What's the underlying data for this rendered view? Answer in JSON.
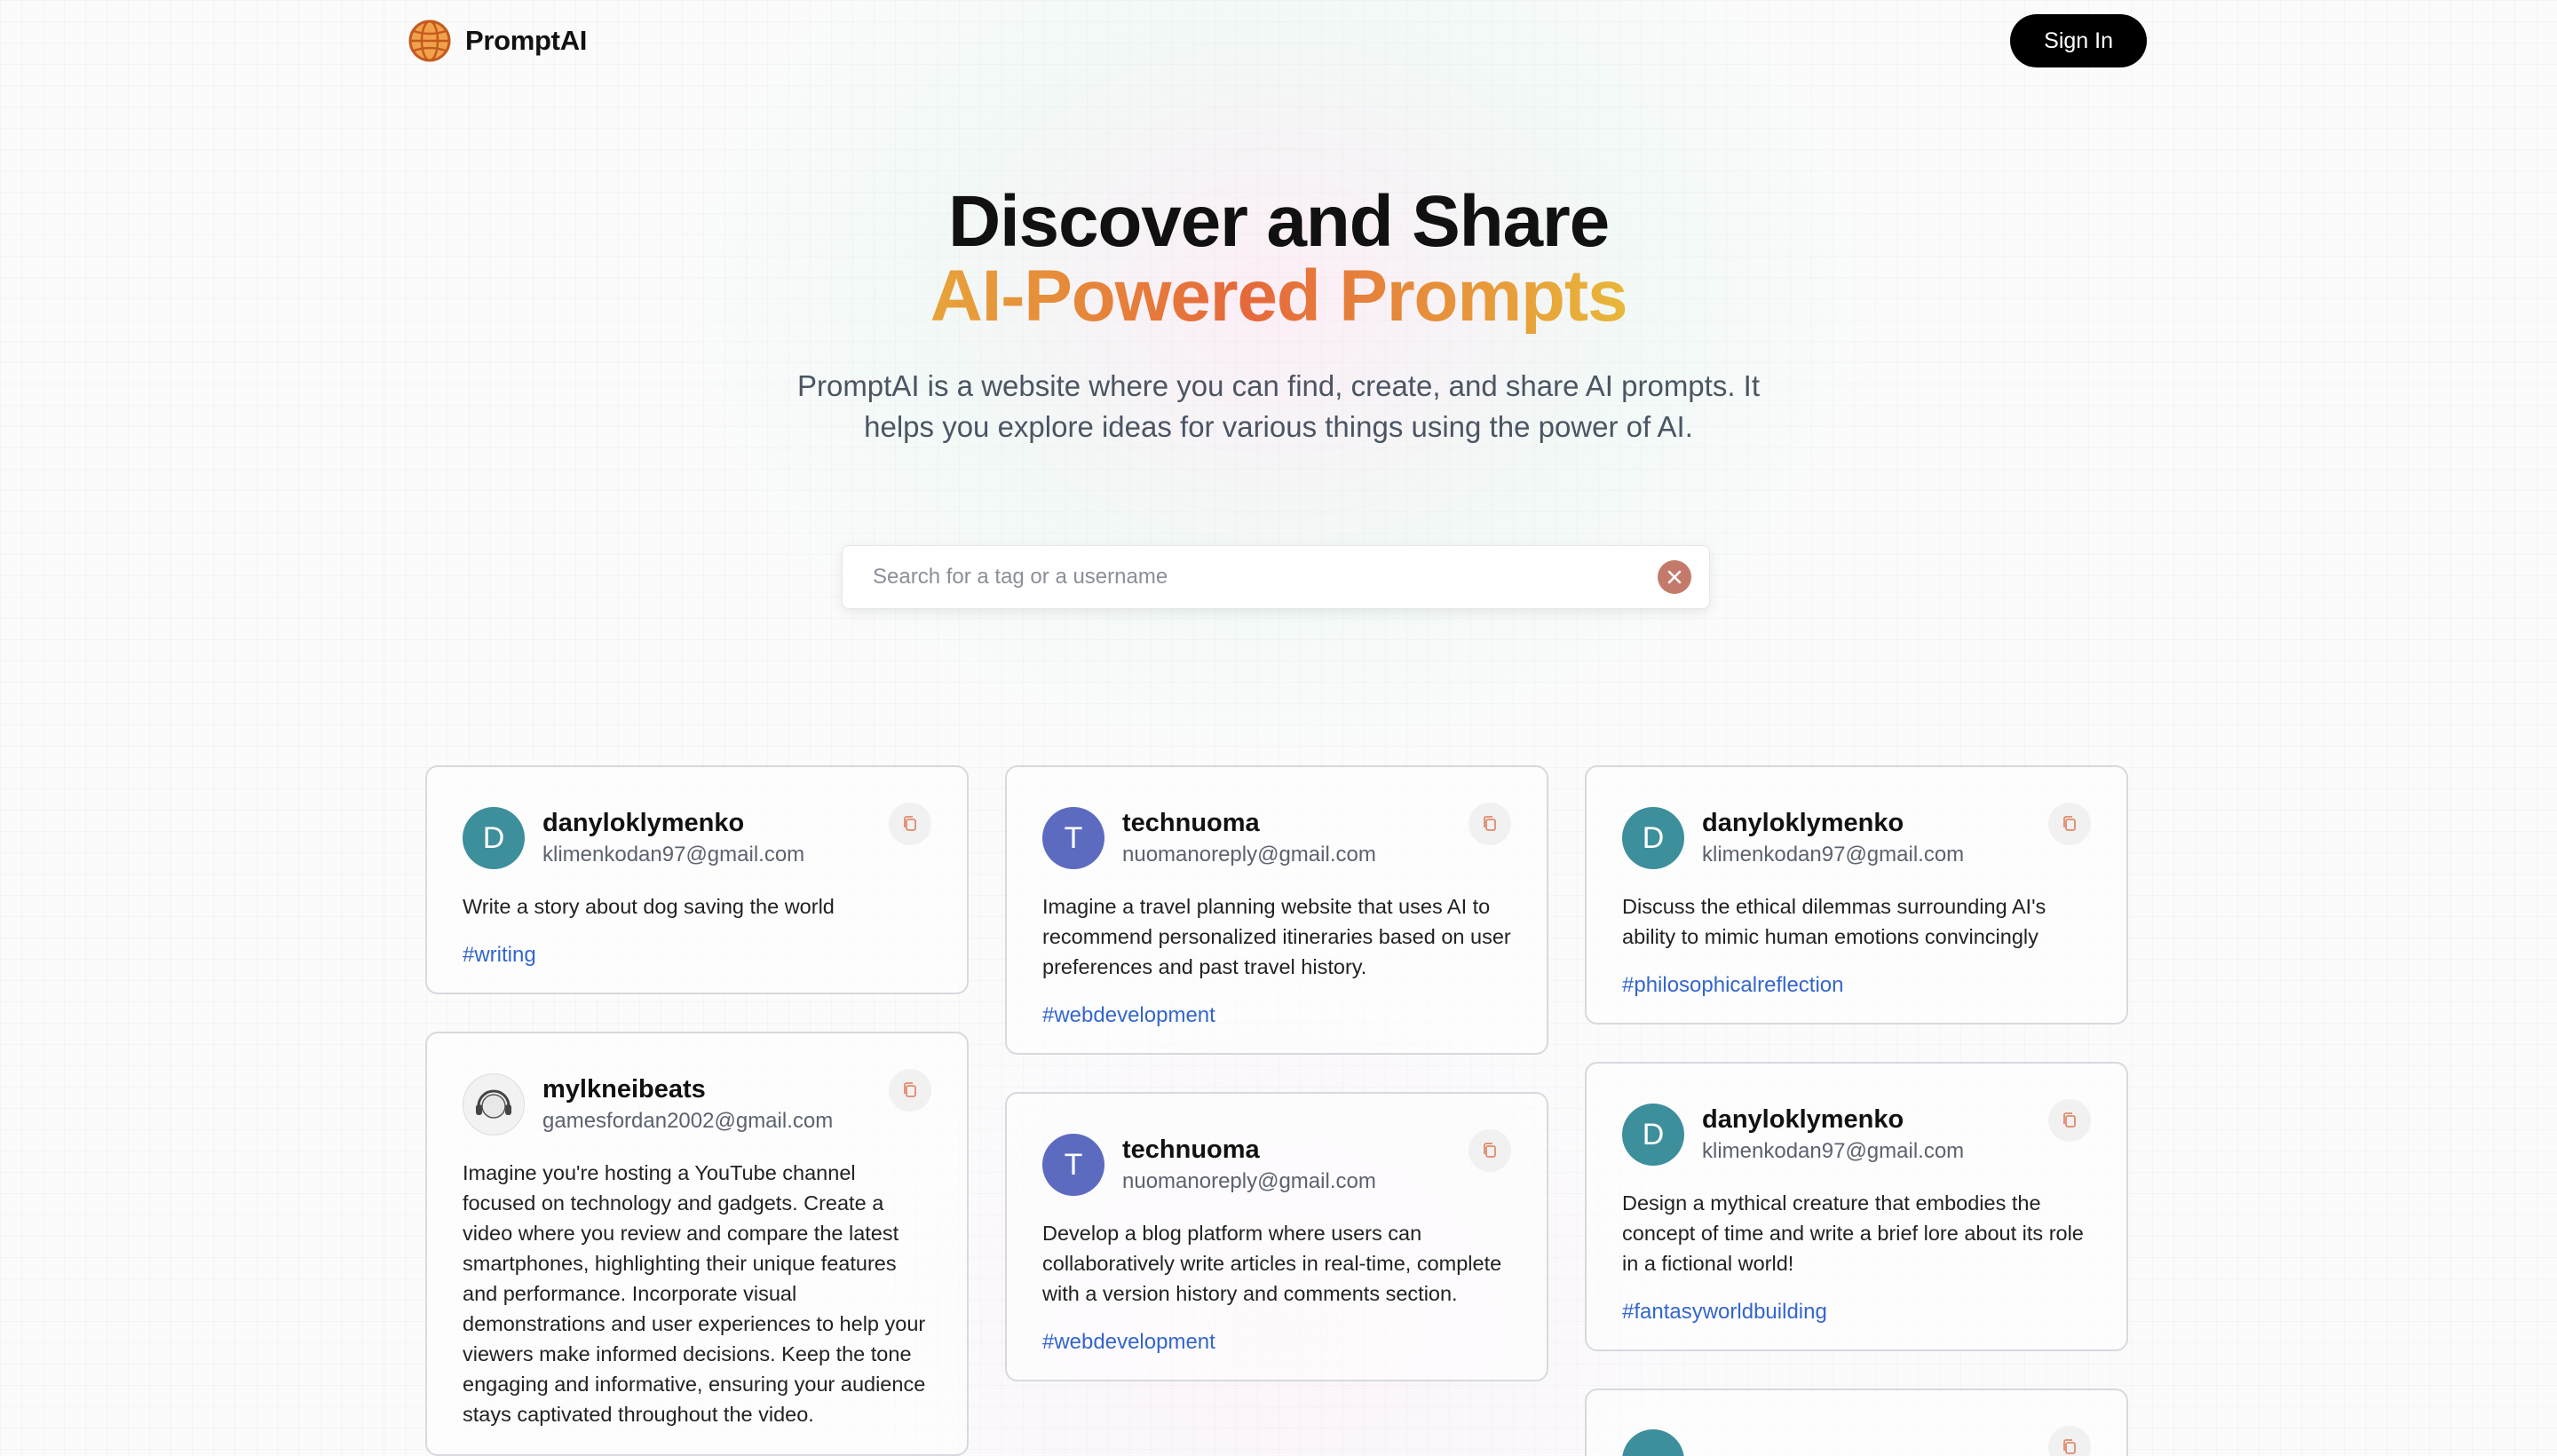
{
  "nav": {
    "brand": "PromptAI",
    "logo_icon": "globe-icon",
    "signin_label": "Sign In"
  },
  "hero": {
    "title_line1": "Discover and Share",
    "title_line2": "AI-Powered Prompts",
    "description": "PromptAI is a website where you can find, create, and share AI prompts. It helps you explore ideas for various things using the power of AI."
  },
  "search": {
    "placeholder": "Search for a tag or a username",
    "value": "",
    "clear_icon": "close-icon"
  },
  "colors": {
    "accent_orange": "#e5683b",
    "tag_blue": "#3366cc",
    "avatar_teal": "#3d8f9c",
    "avatar_indigo": "#5c6bc0"
  },
  "cards": [
    {
      "username": "danyloklymenko",
      "email": "klimenkodan97@gmail.com",
      "avatar_letter": "D",
      "prompt": "Write a story about dog saving the world",
      "tag": "#writing"
    },
    {
      "username": "mylkneibeats",
      "email": "gamesfordan2002@gmail.com",
      "avatar_letter": "",
      "prompt": "Imagine you're hosting a YouTube channel focused on technology and gadgets. Create a video where you review and compare the latest smartphones, highlighting their unique features and performance. Incorporate visual demonstrations and user experiences to help your viewers make informed decisions. Keep the tone engaging and informative, ensuring your audience stays captivated throughout the video."
    },
    {
      "username": "technuoma",
      "email": "nuomanoreply@gmail.com",
      "avatar_letter": "T",
      "prompt": "Imagine a travel planning website that uses AI to recommend personalized itineraries based on user preferences and past travel history.",
      "tag": "#webdevelopment"
    },
    {
      "username": "technuoma",
      "email": "nuomanoreply@gmail.com",
      "avatar_letter": "T",
      "prompt": "Develop a blog platform where users can collaboratively write articles in real-time, complete with a version history and comments section.",
      "tag": "#webdevelopment"
    },
    {
      "username": "danyloklymenko",
      "email": "klimenkodan97@gmail.com",
      "avatar_letter": "D",
      "prompt": "Discuss the ethical dilemmas surrounding AI's ability to mimic human emotions convincingly",
      "tag": "#philosophicalreflection"
    },
    {
      "username": "danyloklymenko",
      "email": "klimenkodan97@gmail.com",
      "avatar_letter": "D",
      "prompt": "Design a mythical creature that embodies the concept of time and write a brief lore about its role in a fictional world!",
      "tag": "#fantasyworldbuilding"
    }
  ]
}
